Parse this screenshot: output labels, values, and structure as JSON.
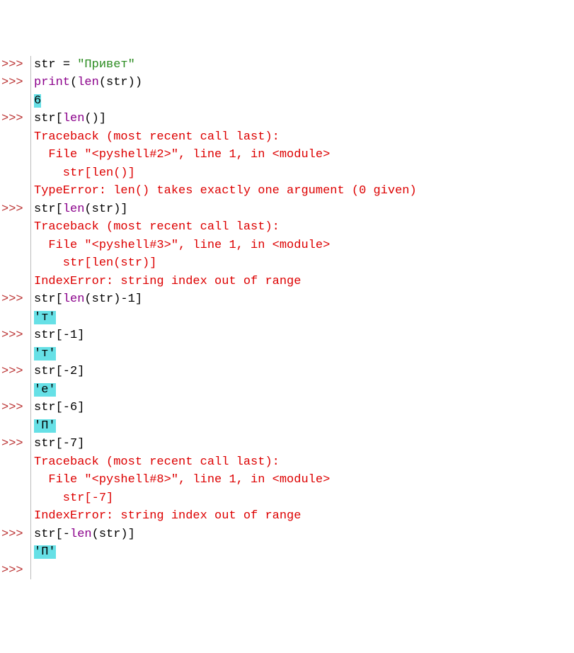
{
  "lines": [
    {
      "prompt": ">>>",
      "segments": [
        {
          "t": "str ",
          "cls": "tok-name"
        },
        {
          "t": "= ",
          "cls": "tok-op"
        },
        {
          "t": "\"Привет\"",
          "cls": "tok-str"
        }
      ]
    },
    {
      "prompt": ">>>",
      "segments": [
        {
          "t": "print",
          "cls": "tok-func"
        },
        {
          "t": "(",
          "cls": "tok-op"
        },
        {
          "t": "len",
          "cls": "tok-func"
        },
        {
          "t": "(str))",
          "cls": "tok-op"
        }
      ]
    },
    {
      "prompt": "",
      "segments": [
        {
          "t": "6",
          "cls": "hl"
        }
      ]
    },
    {
      "prompt": ">>>",
      "segments": [
        {
          "t": "str[",
          "cls": "tok-name"
        },
        {
          "t": "len",
          "cls": "tok-func"
        },
        {
          "t": "()]",
          "cls": "tok-op"
        }
      ]
    },
    {
      "prompt": "",
      "segments": [
        {
          "t": "Traceback (most recent call last):",
          "cls": "tok-err"
        }
      ]
    },
    {
      "prompt": "",
      "segments": [
        {
          "t": "  File \"<pyshell#2>\", line 1, in <module>",
          "cls": "tok-err"
        }
      ]
    },
    {
      "prompt": "",
      "segments": [
        {
          "t": "    str[len()]",
          "cls": "tok-err"
        }
      ]
    },
    {
      "prompt": "",
      "segments": [
        {
          "t": "TypeError: len() takes exactly one argument (0 given)",
          "cls": "tok-err"
        }
      ]
    },
    {
      "prompt": ">>>",
      "segments": [
        {
          "t": "str[",
          "cls": "tok-name"
        },
        {
          "t": "len",
          "cls": "tok-func"
        },
        {
          "t": "(str)]",
          "cls": "tok-op"
        }
      ]
    },
    {
      "prompt": "",
      "segments": [
        {
          "t": "Traceback (most recent call last):",
          "cls": "tok-err"
        }
      ]
    },
    {
      "prompt": "",
      "segments": [
        {
          "t": "  File \"<pyshell#3>\", line 1, in <module>",
          "cls": "tok-err"
        }
      ]
    },
    {
      "prompt": "",
      "segments": [
        {
          "t": "    str[len(str)]",
          "cls": "tok-err"
        }
      ]
    },
    {
      "prompt": "",
      "segments": [
        {
          "t": "IndexError: string index out of range",
          "cls": "tok-err"
        }
      ]
    },
    {
      "prompt": ">>>",
      "segments": [
        {
          "t": "str[",
          "cls": "tok-name"
        },
        {
          "t": "len",
          "cls": "tok-func"
        },
        {
          "t": "(str)-",
          "cls": "tok-op"
        },
        {
          "t": "1",
          "cls": "tok-num"
        },
        {
          "t": "]",
          "cls": "tok-op"
        }
      ]
    },
    {
      "prompt": "",
      "segments": [
        {
          "t": "'т'",
          "cls": "hl"
        }
      ]
    },
    {
      "prompt": ">>>",
      "segments": [
        {
          "t": "str[-",
          "cls": "tok-name"
        },
        {
          "t": "1",
          "cls": "tok-num"
        },
        {
          "t": "]",
          "cls": "tok-op"
        }
      ]
    },
    {
      "prompt": "",
      "segments": [
        {
          "t": "'т'",
          "cls": "hl"
        }
      ]
    },
    {
      "prompt": ">>>",
      "segments": [
        {
          "t": "str[-",
          "cls": "tok-name"
        },
        {
          "t": "2",
          "cls": "tok-num"
        },
        {
          "t": "]",
          "cls": "tok-op"
        }
      ]
    },
    {
      "prompt": "",
      "segments": [
        {
          "t": "'е'",
          "cls": "hl"
        }
      ]
    },
    {
      "prompt": ">>>",
      "segments": [
        {
          "t": "str[-",
          "cls": "tok-name"
        },
        {
          "t": "6",
          "cls": "tok-num"
        },
        {
          "t": "]",
          "cls": "tok-op"
        }
      ]
    },
    {
      "prompt": "",
      "segments": [
        {
          "t": "'П'",
          "cls": "hl"
        }
      ]
    },
    {
      "prompt": ">>>",
      "segments": [
        {
          "t": "str[-",
          "cls": "tok-name"
        },
        {
          "t": "7",
          "cls": "tok-num"
        },
        {
          "t": "]",
          "cls": "tok-op"
        }
      ]
    },
    {
      "prompt": "",
      "segments": [
        {
          "t": "Traceback (most recent call last):",
          "cls": "tok-err"
        }
      ]
    },
    {
      "prompt": "",
      "segments": [
        {
          "t": "  File \"<pyshell#8>\", line 1, in <module>",
          "cls": "tok-err"
        }
      ]
    },
    {
      "prompt": "",
      "segments": [
        {
          "t": "    str[-7]",
          "cls": "tok-err"
        }
      ]
    },
    {
      "prompt": "",
      "segments": [
        {
          "t": "IndexError: string index out of range",
          "cls": "tok-err"
        }
      ]
    },
    {
      "prompt": ">>>",
      "segments": [
        {
          "t": "str[-",
          "cls": "tok-name"
        },
        {
          "t": "len",
          "cls": "tok-func"
        },
        {
          "t": "(str)]",
          "cls": "tok-op"
        }
      ]
    },
    {
      "prompt": "",
      "segments": [
        {
          "t": "'П'",
          "cls": "hl"
        }
      ]
    },
    {
      "prompt": ">>>",
      "segments": []
    }
  ]
}
